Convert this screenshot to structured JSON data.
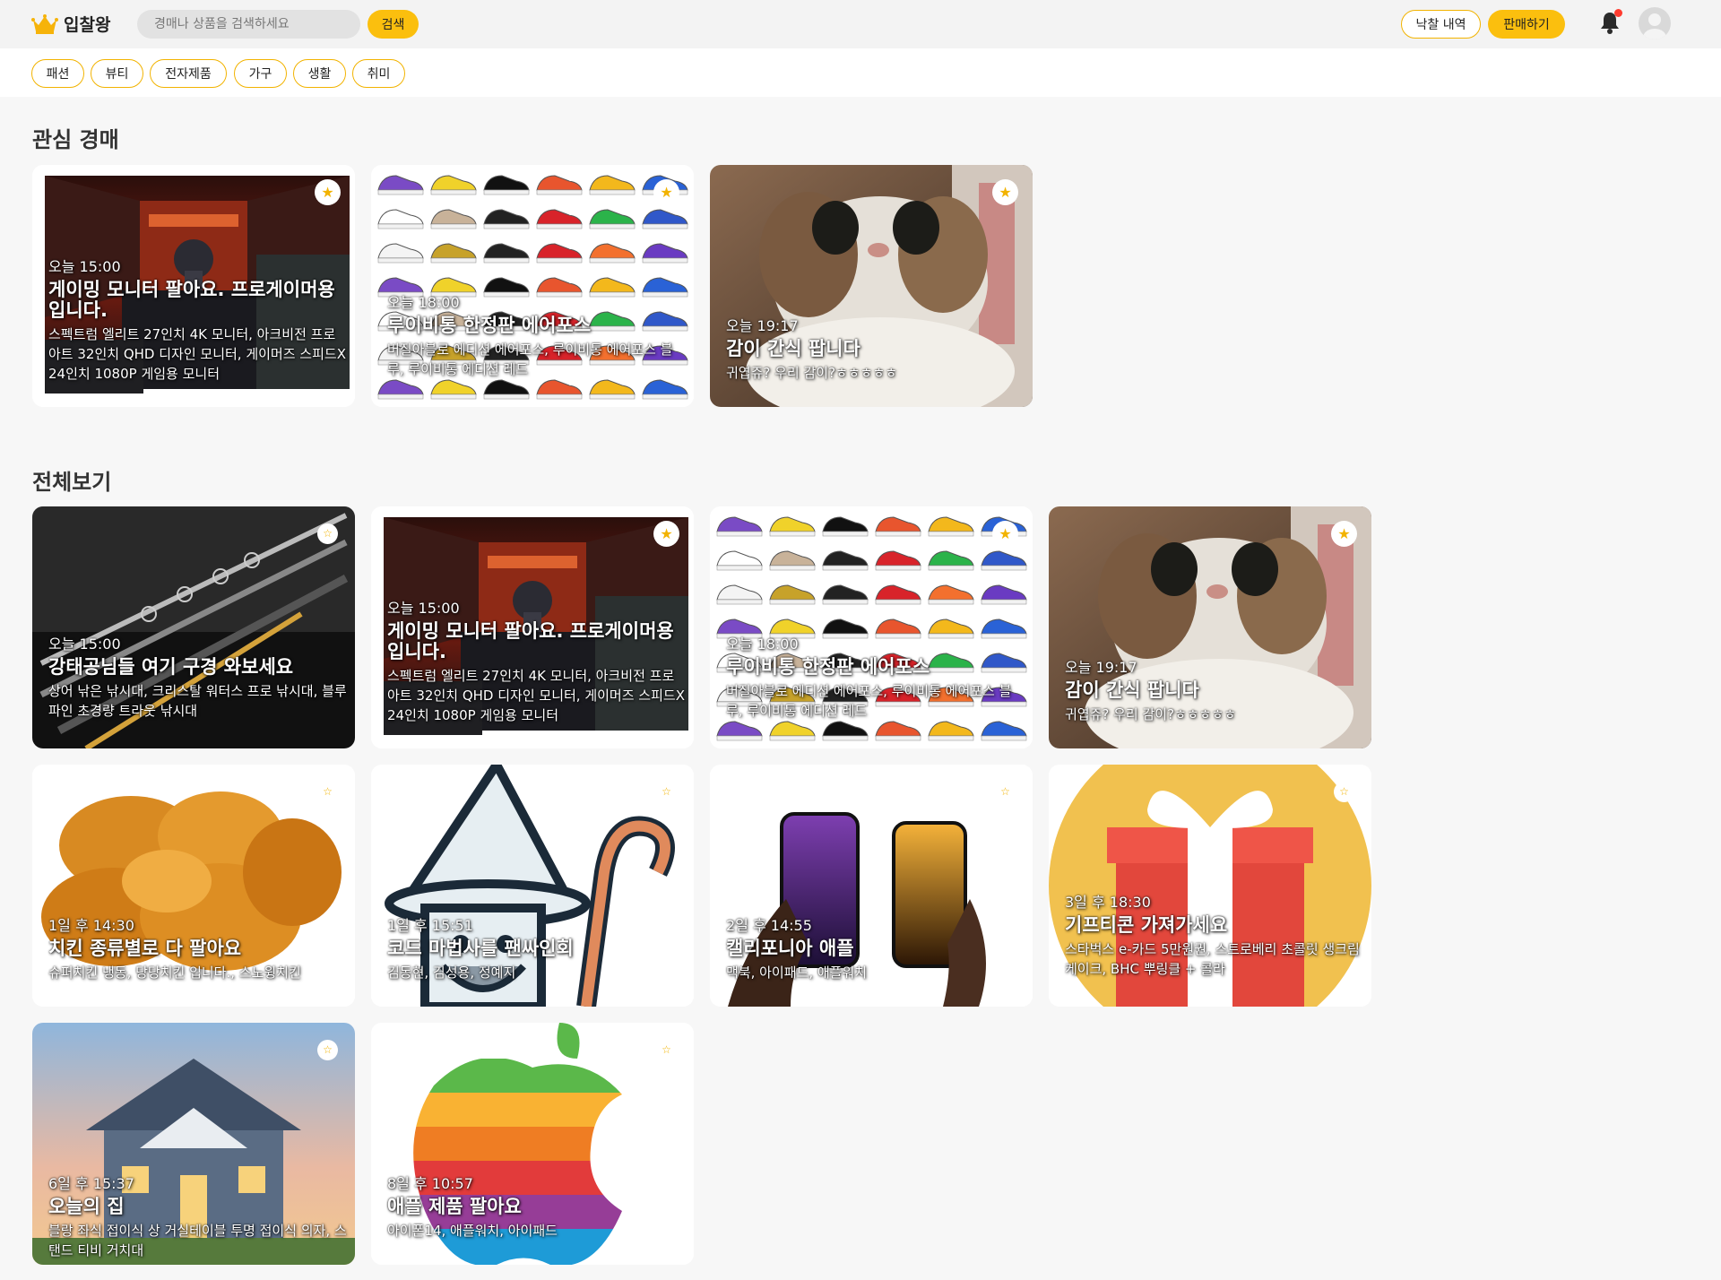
{
  "header": {
    "logo_text": "입찰왕",
    "search_placeholder": "경매나 상품을 검색하세요",
    "search_button": "검색",
    "history_button": "낙찰 내역",
    "sell_button": "판매하기",
    "accent_color": "#fbbf0e"
  },
  "categories": [
    "패션",
    "뷰티",
    "전자제품",
    "가구",
    "생활",
    "취미"
  ],
  "sections": {
    "interest": "관심 경매",
    "all": "전체보기"
  },
  "interest_items": [
    {
      "time": "오늘 15:00",
      "title": "게이밍 모니터 팔아요. 프로게이머용 입니다.",
      "desc": "스펙트럼 엘리트 27인치 4K 모니터, 아크비전 프로아트 32인치 QHD 디자인 모니터, 게이머즈 스피드X 24인치 1080P 게임용 모니터",
      "starred": true,
      "image": "gaming-monitors"
    },
    {
      "time": "오늘 18:00",
      "title": "루이비통 한정판 에어포스",
      "desc": "버질아블로 에디션 에어포스, 루이비통 에어포스 블루, 루이비통 에디션 레드",
      "starred": true,
      "image": "sneakers-grid"
    },
    {
      "time": "오늘 19:17",
      "title": "감이 간식 팝니다",
      "desc": "귀엽쥬? 우리 감이?ㅎㅎㅎㅎㅎ",
      "starred": true,
      "image": "cat-photo"
    }
  ],
  "all_items": [
    {
      "time": "오늘 15:00",
      "title": "강태공님들 여기 구경 와보세요",
      "desc": "상어 낚은 낚시대, 크리스탈 워터스 프로 낚시대, 블루 파인 초경량 트라웃 낚시대",
      "starred": false,
      "image": "fishing-rods"
    },
    {
      "time": "오늘 15:00",
      "title": "게이밍 모니터 팔아요. 프로게이머용 입니다.",
      "desc": "스펙트럼 엘리트 27인치 4K 모니터, 아크비전 프로아트 32인치 QHD 디자인 모니터, 게이머즈 스피드X 24인치 1080P 게임용 모니터",
      "starred": true,
      "image": "gaming-monitors"
    },
    {
      "time": "오늘 18:00",
      "title": "루이비통 한정판 에어포스",
      "desc": "버질아블로 에디션 에어포스, 루이비통 에어포스 블루, 루이비통 에디션 레드",
      "starred": true,
      "image": "sneakers-grid"
    },
    {
      "time": "오늘 19:17",
      "title": "감이 간식 팝니다",
      "desc": "귀엽쥬? 우리 감이?ㅎㅎㅎㅎㅎ",
      "starred": true,
      "image": "cat-photo"
    },
    {
      "time": "1일 후 14:30",
      "title": "치킨 종류별로 다 팔아요",
      "desc": "슈퍼치킨 냉동, 당당치킨 입니다., 스노윙치킨",
      "starred": false,
      "image": "fried-chicken"
    },
    {
      "time": "1일 후 15:51",
      "title": "코드 마법사를 팬싸인회",
      "desc": "김동현, 김성용, 정예지",
      "starred": false,
      "image": "wizard-illustration"
    },
    {
      "time": "2일 후 14:55",
      "title": "캘리포니아 애플",
      "desc": "맥북, 아이패드, 애플워치",
      "starred": false,
      "image": "iphones"
    },
    {
      "time": "3일 후 18:30",
      "title": "기프티콘 가져가세요",
      "desc": "스타벅스 e-카드 5만원권, 스트로베리 초콜릿 생크림 케이크, BHC 뿌링클 + 콜라",
      "starred": false,
      "image": "gift-box"
    },
    {
      "time": "6일 후 15:37",
      "title": "오늘의 집",
      "desc": "블랑 좌식 접이식 상 거실테이블 투명 접이식 의자, 스탠드 티비 거치대",
      "starred": false,
      "image": "house"
    },
    {
      "time": "8일 후 10:57",
      "title": "애플 제품 팔아요",
      "desc": "아이폰14, 애플워치, 아이패드",
      "starred": false,
      "image": "apple-logo"
    }
  ]
}
